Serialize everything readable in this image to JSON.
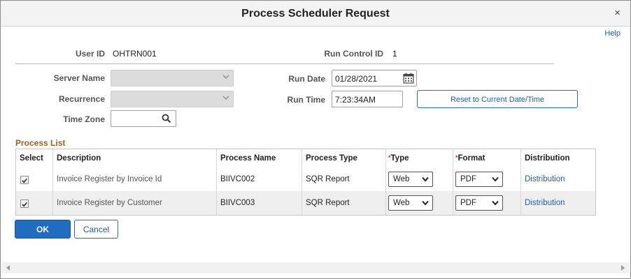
{
  "dialog": {
    "title": "Process Scheduler Request",
    "close_label": "×",
    "help_label": "Help"
  },
  "header": {
    "user_id_label": "User ID",
    "user_id": "OHTRN001",
    "run_control_label": "Run Control ID",
    "run_control_id": "1"
  },
  "form": {
    "server_name_label": "Server Name",
    "server_name": "",
    "recurrence_label": "Recurrence",
    "recurrence": "",
    "time_zone_label": "Time Zone",
    "time_zone": "",
    "run_date_label": "Run Date",
    "run_date": "01/28/2021",
    "run_time_label": "Run Time",
    "run_time": "7:23:34AM",
    "reset_label": "Reset to Current Date/Time"
  },
  "process_list": {
    "title": "Process List",
    "columns": {
      "select": "Select",
      "description": "Description",
      "process_name": "Process Name",
      "process_type": "Process Type",
      "type": "Type",
      "format": "Format",
      "distribution": "Distribution",
      "required_mark": "*"
    },
    "rows": [
      {
        "selected": true,
        "description": "Invoice Register by Invoice Id",
        "process_name": "BIIVC002",
        "process_type": "SQR Report",
        "type": "Web",
        "format": "PDF",
        "distribution": "Distribution"
      },
      {
        "selected": true,
        "description": "Invoice Register by Customer",
        "process_name": "BIIVC003",
        "process_type": "SQR Report",
        "type": "Web",
        "format": "PDF",
        "distribution": "Distribution"
      }
    ]
  },
  "buttons": {
    "ok": "OK",
    "cancel": "Cancel"
  },
  "colors": {
    "accent": "#1f6cc0",
    "section_title": "#a65d1a",
    "link": "#1f5ea8"
  },
  "icons": {
    "calendar": "calendar-icon",
    "search": "search-icon",
    "close": "close-icon"
  }
}
